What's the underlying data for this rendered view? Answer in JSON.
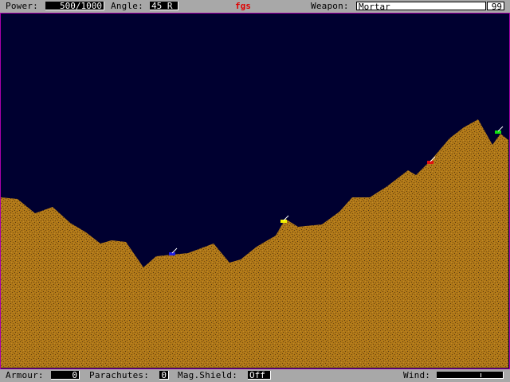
{
  "top_bar": {
    "power_label": "Power:",
    "power_value": "500/1000",
    "angle_label": "Angle:",
    "angle_value": "45 R",
    "player_name": "fgs",
    "weapon_label": "Weapon:",
    "weapon_value": "Mortar",
    "weapon_count": "99"
  },
  "bottom_bar": {
    "armour_label": "Armour:",
    "armour_value": "0",
    "parachutes_label": "Parachutes:",
    "parachutes_value": "0",
    "shield_label": "Mag.Shield:",
    "shield_value": "Off",
    "wind_label": "Wind:",
    "wind_level": 0.67
  },
  "colors": {
    "sky": "#000030",
    "ground": "#b07818",
    "ground_speckle": "#5a3a10",
    "border": "#a800a8"
  },
  "tanks": [
    {
      "name": "blue-tank",
      "color": "#2020e0"
    },
    {
      "name": "yellow-tank",
      "color": "#f0f000"
    },
    {
      "name": "red-tank",
      "color": "#e01010"
    },
    {
      "name": "green-tank",
      "color": "#10e010"
    }
  ]
}
